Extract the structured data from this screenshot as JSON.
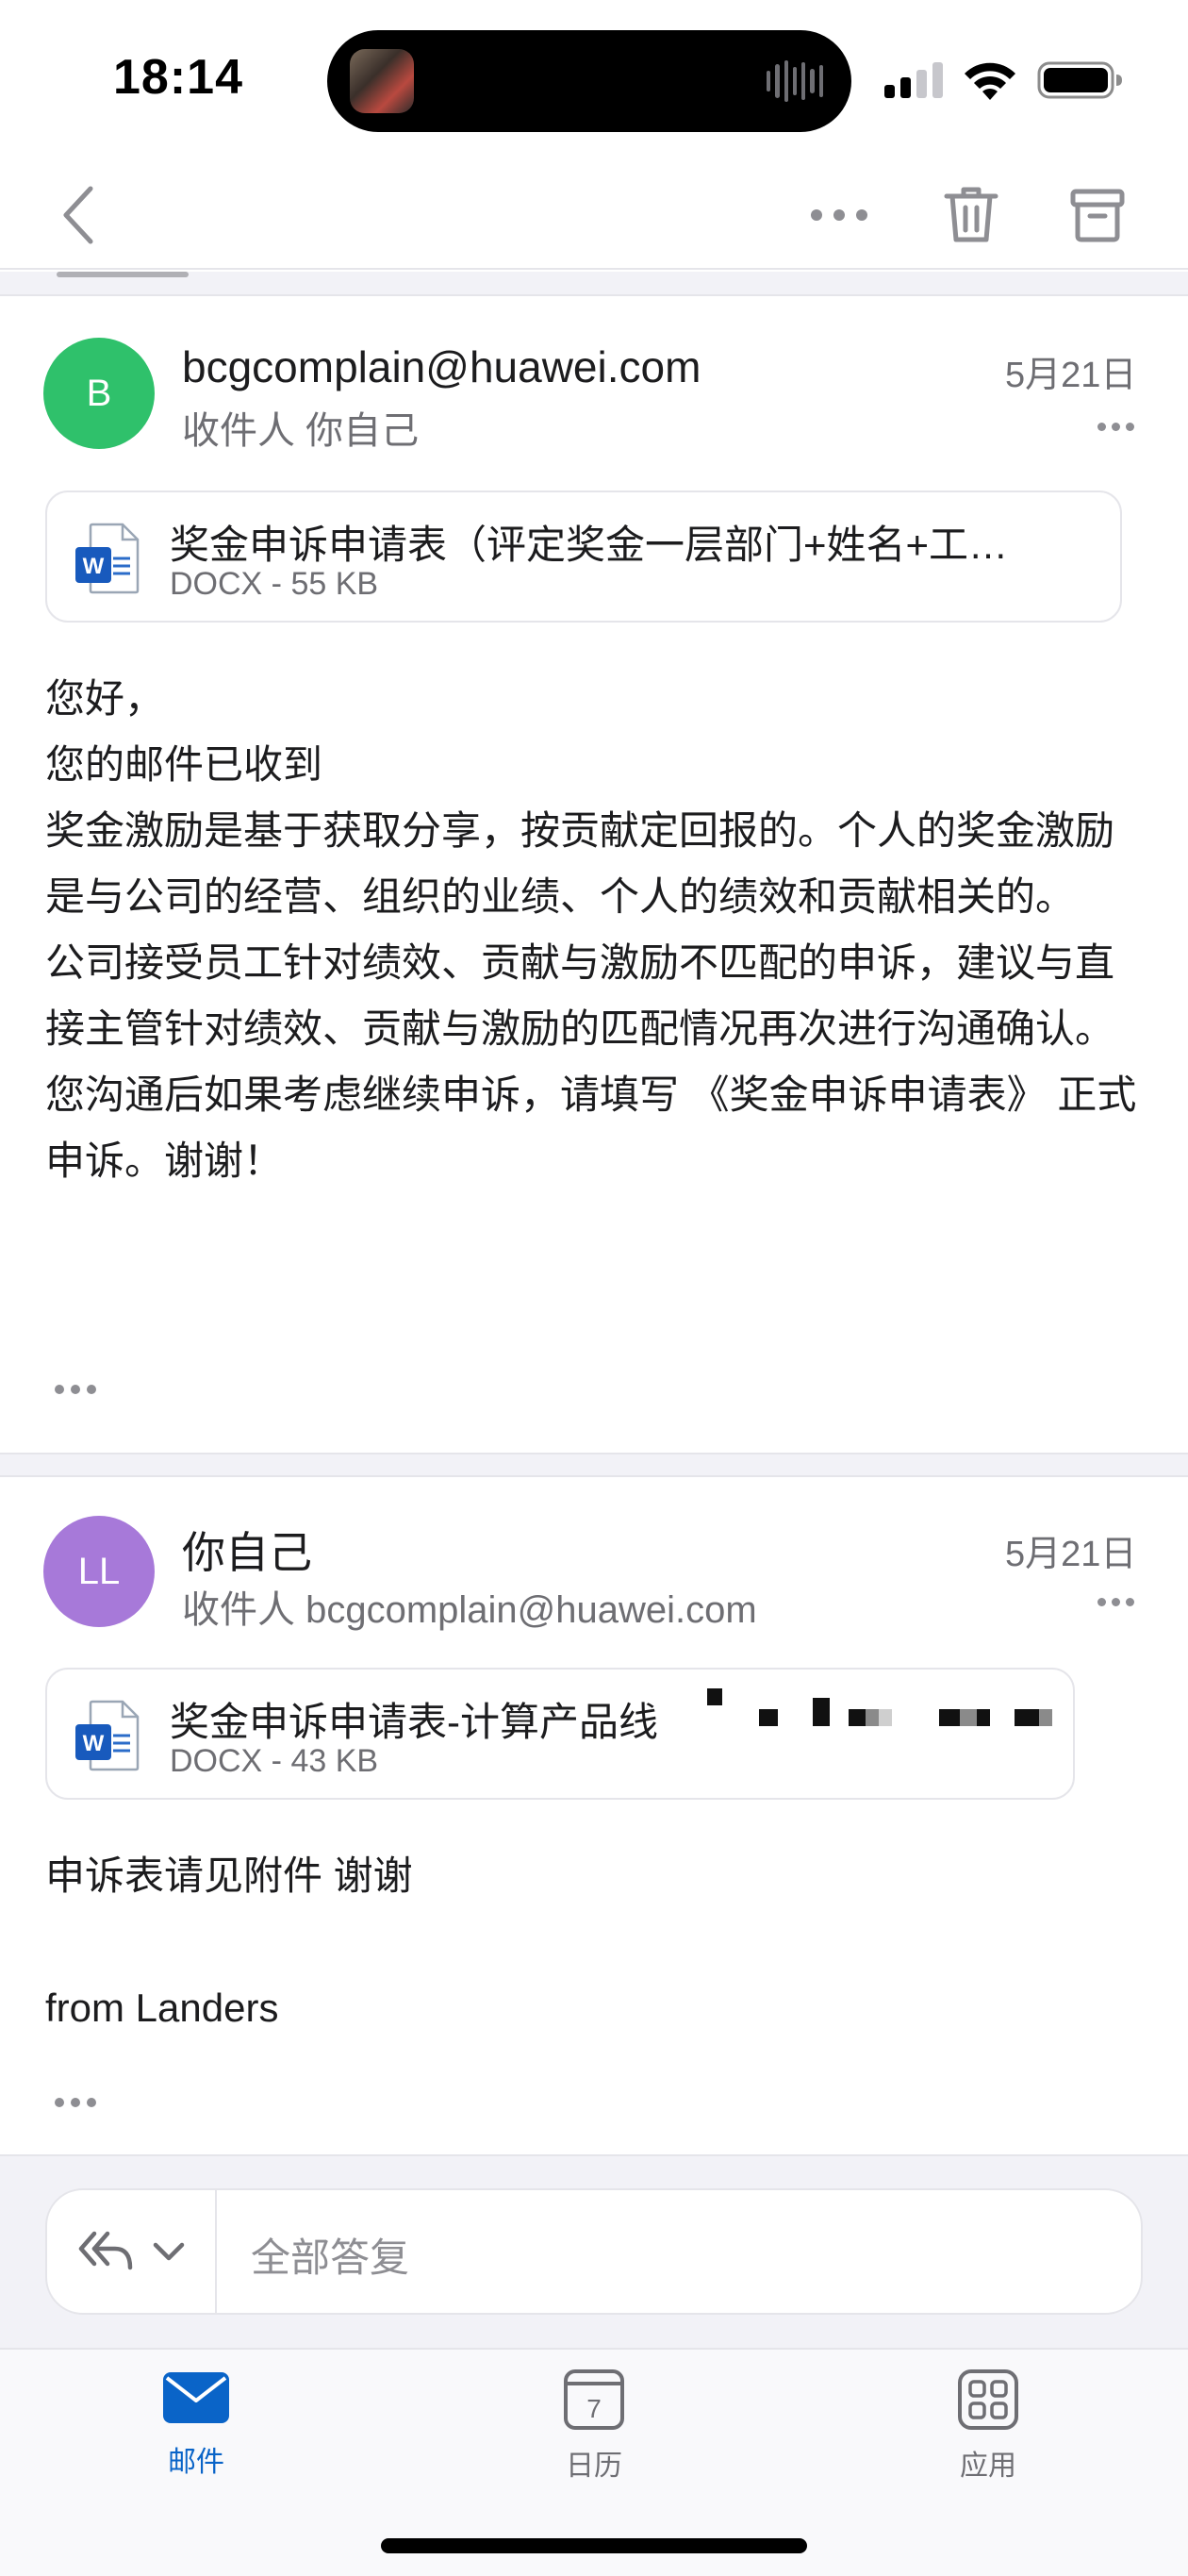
{
  "status": {
    "time": "18:14"
  },
  "messages": [
    {
      "avatar_letter": "B",
      "avatar_color": "#2fc16b",
      "sender": "bcgcomplain@huawei.com",
      "recipient": "收件人 你自己",
      "date": "5月21日",
      "attachment": {
        "name": "奖金申诉申请表（评定奖金一层部门+姓名+工…",
        "size": "DOCX - 55 KB"
      },
      "body": [
        "您好，",
        "您的邮件已收到",
        "奖金激励是基于获取分享，按贡献定回报的。个人的奖金激励是与公司的经营、组织的业绩、个人的绩效和贡献相关的。",
        "公司接受员工针对绩效、贡献与激励不匹配的申诉，建议与直接主管针对绩效、贡献与激励的匹配情况再次进行沟通确认。",
        "您沟通后如果考虑继续申诉，请填写 《奖金申诉申请表》 正式申诉。谢谢！"
      ]
    },
    {
      "avatar_letter": "LL",
      "avatar_color": "#a779d9",
      "sender": "你自己",
      "recipient": "收件人 bcgcomplain@huawei.com",
      "date": "5月21日",
      "attachment": {
        "name": "奖金申诉申请表-计算产品线",
        "size": "DOCX - 43 KB"
      },
      "body": [
        "申诉表请见附件 谢谢",
        "",
        "from Landers"
      ]
    }
  ],
  "reply": {
    "placeholder": "全部答复"
  },
  "tabs": [
    {
      "label": "邮件",
      "icon": "mail-icon",
      "active": true
    },
    {
      "label": "日历",
      "icon": "calendar-icon",
      "day": "7"
    },
    {
      "label": "应用",
      "icon": "apps-icon"
    }
  ],
  "accent_color": "#0a64c8"
}
